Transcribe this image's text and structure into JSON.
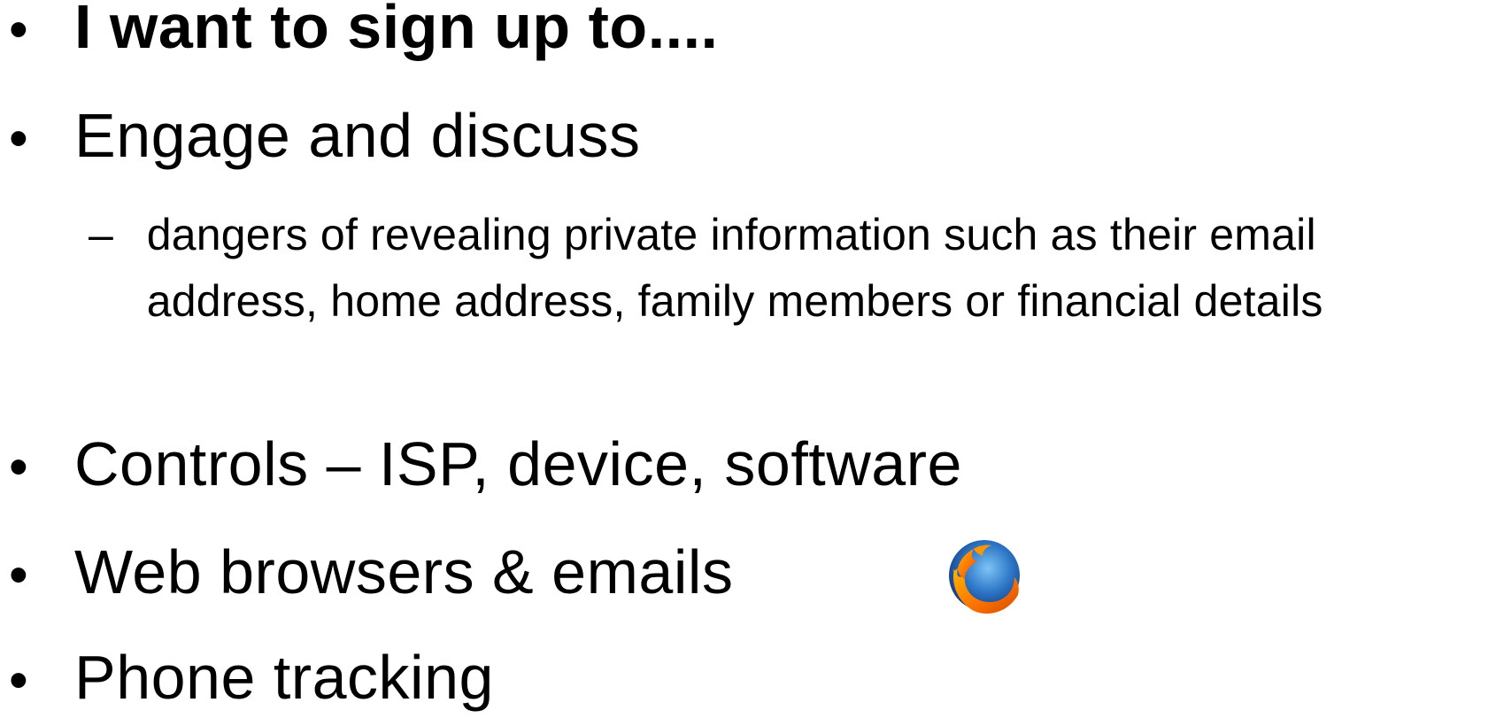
{
  "slide": {
    "bullets": [
      {
        "text": "I want to sign up to....",
        "bold": true
      },
      {
        "text": "Engage and discuss"
      },
      {
        "text": "Controls – ISP, device, software"
      },
      {
        "text": "Web browsers & emails"
      },
      {
        "text": "Phone tracking"
      }
    ],
    "sub_bullet": {
      "glyph": "–",
      "text": "dangers of revealing private information such as their email address, home address, family members or financial details"
    },
    "bullet_glyph": "•",
    "logo": {
      "icon": "firefox-logo-icon",
      "colors": [
        "#e66000",
        "#ff9500",
        "#1f5fa8",
        "#4fa3e0"
      ]
    }
  }
}
